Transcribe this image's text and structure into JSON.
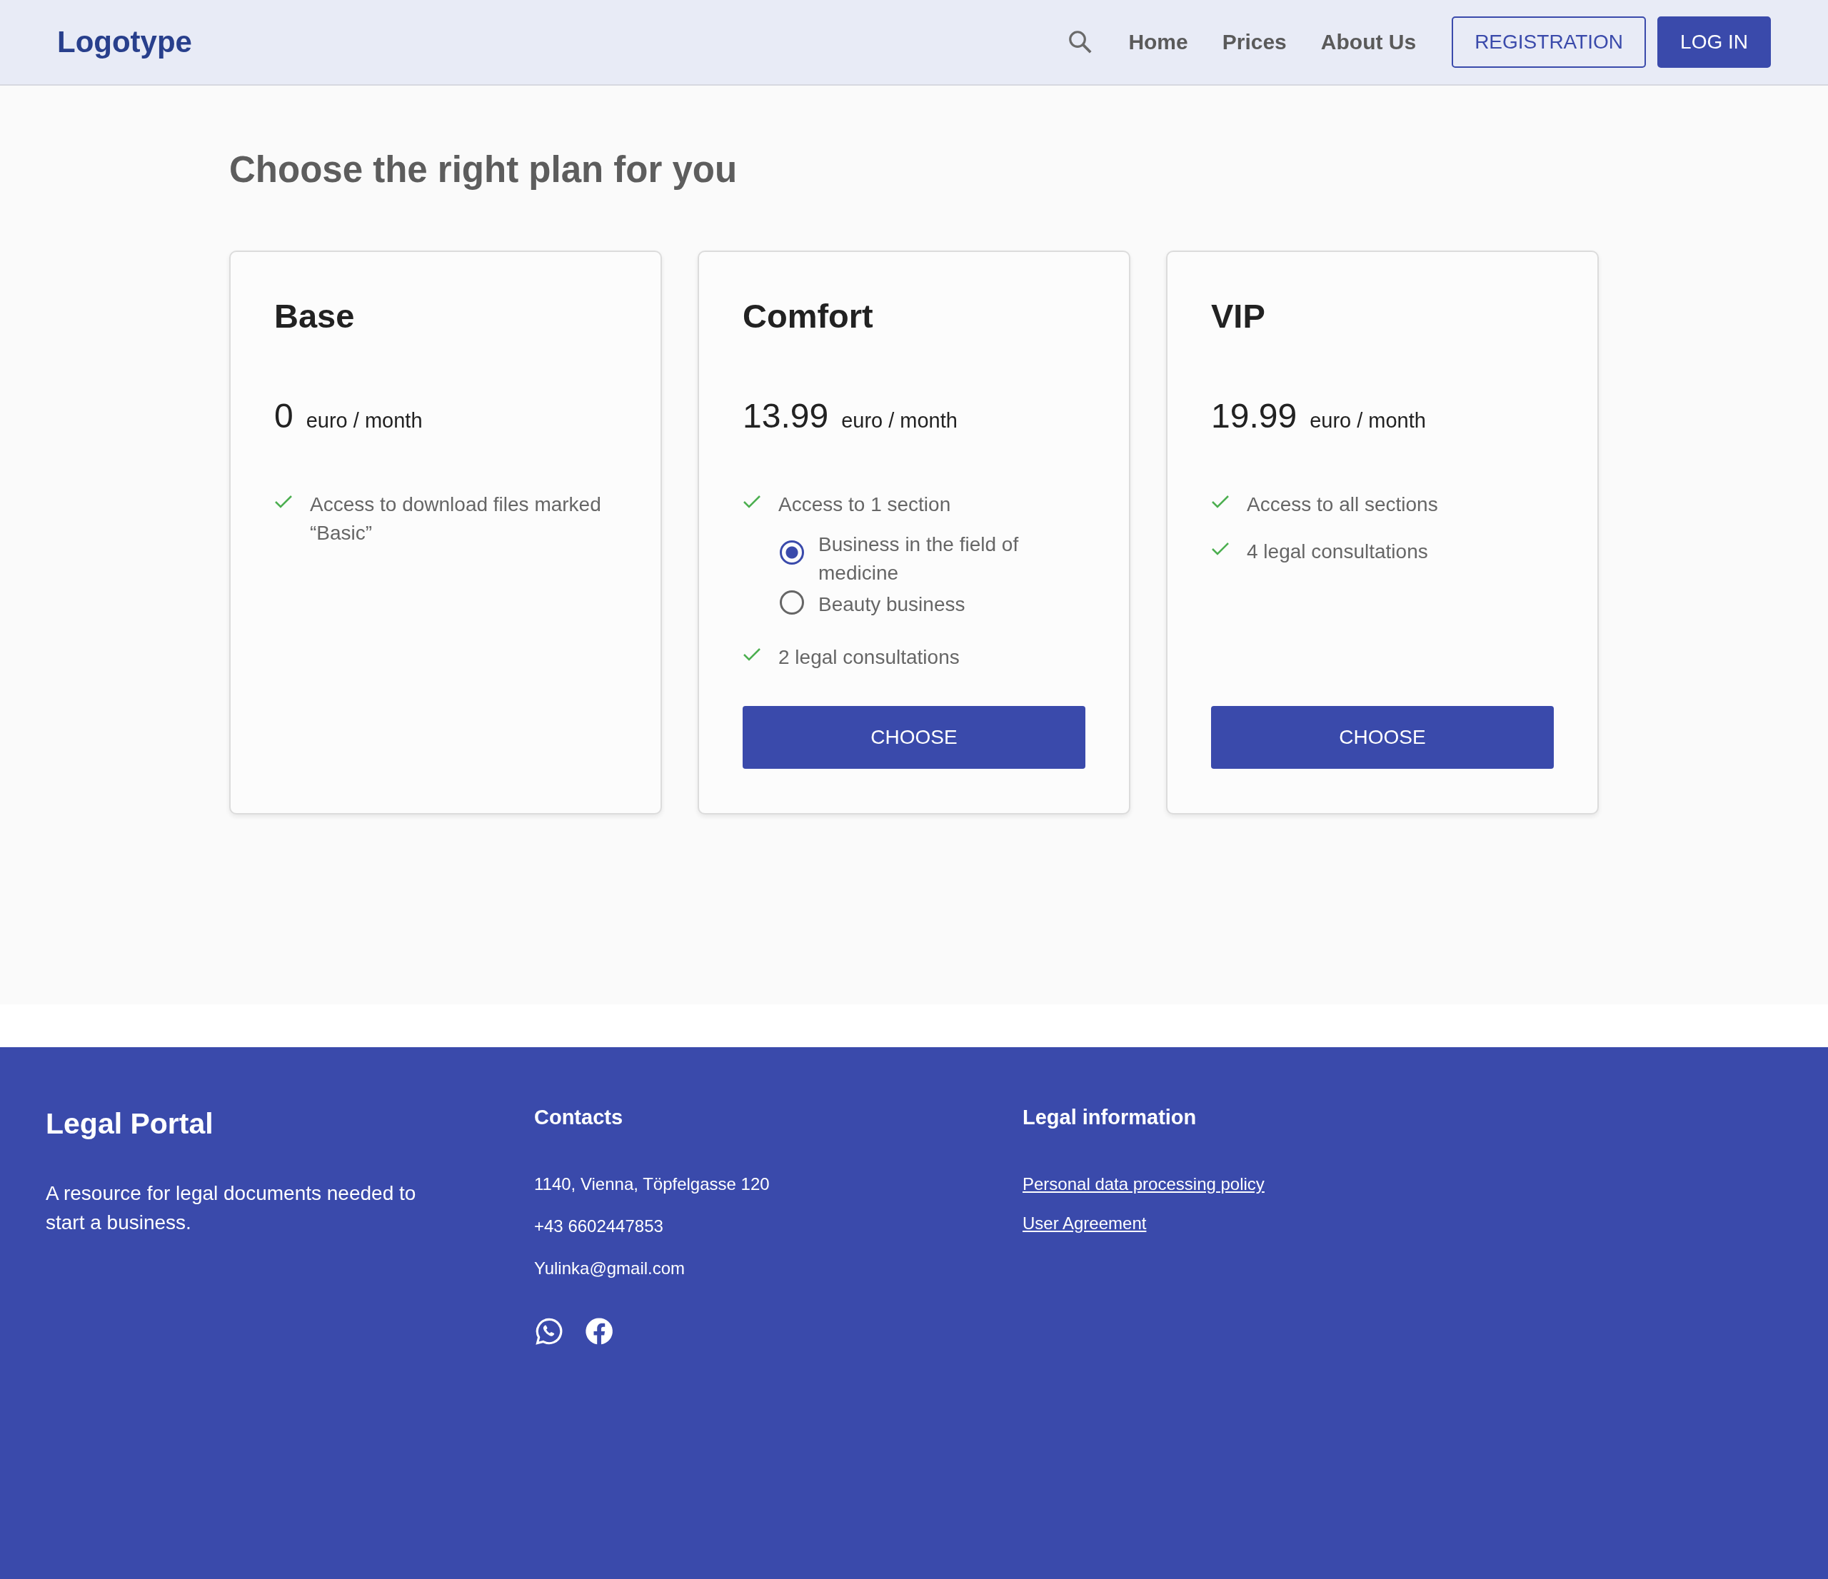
{
  "header": {
    "logo": "Logotype",
    "nav": [
      {
        "label": "Home"
      },
      {
        "label": "Prices"
      },
      {
        "label": "About Us"
      }
    ],
    "buttons": [
      {
        "label": "REGISTRATION",
        "kind": "outline"
      },
      {
        "label": "LOG IN",
        "kind": "filled"
      }
    ]
  },
  "heading": "Choose the right plan for you",
  "plans": [
    {
      "name": "Base",
      "price": "0",
      "unit": "euro / month",
      "features": [
        {
          "kind": "check",
          "text": "Access to download files marked “Basic”"
        }
      ]
    },
    {
      "name": "Comfort",
      "price": "13.99",
      "unit": "euro / month",
      "features": [
        {
          "kind": "check",
          "text": "Access to 1 section"
        },
        {
          "kind": "options",
          "options": [
            {
              "label": "Business in the field of medicine",
              "selected": true
            },
            {
              "label": "Beauty business",
              "selected": false
            }
          ]
        },
        {
          "kind": "check",
          "text": "2 legal consultations"
        }
      ],
      "button": "CHOOSE"
    },
    {
      "name": "VIP",
      "price": "19.99",
      "unit": "euro / month",
      "features": [
        {
          "kind": "check",
          "text": "Access to all sections"
        },
        {
          "kind": "check",
          "text": "4 legal consultations"
        }
      ],
      "button": "CHOOSE"
    }
  ],
  "footer": {
    "brand": "Legal Portal",
    "description": "A resource for legal documents needed to start a business.",
    "contacts": {
      "title": "Contacts",
      "lines": [
        "1140, Vienna, Töpfelgasse 120",
        "+43  6602447853",
        "Yulinka@gmail.com"
      ]
    },
    "legal": {
      "title": "Legal information",
      "links": [
        "Personal data processing policy",
        "User Agreement"
      ]
    }
  }
}
